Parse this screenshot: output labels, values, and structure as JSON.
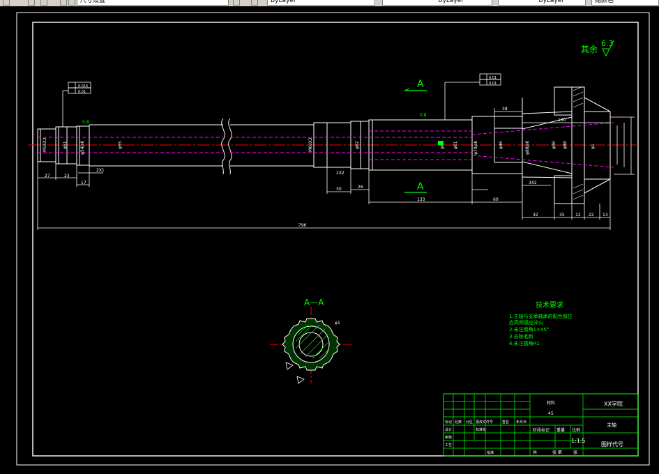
{
  "toolbar": {
    "scale_label": "尺寸设置",
    "layer_combo_1": "ByLayer",
    "layer_combo_2": "ByLayer",
    "layer_combo_3": "ByLayer",
    "color_combo": "随颜色"
  },
  "drawing": {
    "roughness_prefix": "其余",
    "roughness_value": "6.3",
    "section_mark": "A",
    "section_label": "A—A",
    "dims": {
      "m16x2": "M16X2",
      "d51": "φ51",
      "d54": "φ54js6",
      "d55": "φ55",
      "m60x2": "M60X2",
      "d62": "φ62",
      "d60": "φ60",
      "d61": "φ61",
      "d70": "φ70js6",
      "d46": "φ46",
      "d88": "φ88js6",
      "d98": "φ98",
      "d88b": "φ88",
      "d_right": "φ1",
      "l27": "27",
      "l23": "23",
      "l17": "17",
      "l2x1": "2X1",
      "l2x2": "2X2",
      "l30": "30",
      "l26": "26",
      "l133": "133",
      "l60": "60",
      "l3x2": "3X2",
      "l32": "32",
      "l35": "35",
      "l12": "12",
      "l22": "22",
      "l13": "13",
      "l38": "38",
      "l130": "130",
      "total": "796",
      "tol1": "0.8",
      "tol2": "0.8",
      "tol3": "0.8",
      "fc1": "0.015",
      "fc2": "0.01",
      "fc3": "0.01",
      "fc4": "0.01",
      "s1": "6.3"
    }
  },
  "tech": {
    "title": "技术要求",
    "items": [
      "1.主轴与支承轴承的配合部位",
      "   应高频感应淬火",
      "2.未注倒角1×45°",
      "3.去除毛刺",
      "4.未注圆角R1"
    ]
  },
  "title_block": {
    "school": "XX学院",
    "part_name": "主轴",
    "drawing_no_label": "图样代号",
    "material": "45",
    "material_label": "材料",
    "scale": "1:1.5",
    "stage_label": "阶段标记",
    "weight_label": "重量",
    "ratio_label": "比例",
    "sheet_total": "共",
    "sheet_label": "张 第",
    "sheet_unit": "张",
    "row_labels": [
      "标记",
      "处数",
      "分区",
      "更改文件号",
      "签名",
      "年月日"
    ],
    "design_label": "设计",
    "standard_label": "标准化",
    "check_label": "审核",
    "process_label": "工艺",
    "approve_label": "批准"
  }
}
